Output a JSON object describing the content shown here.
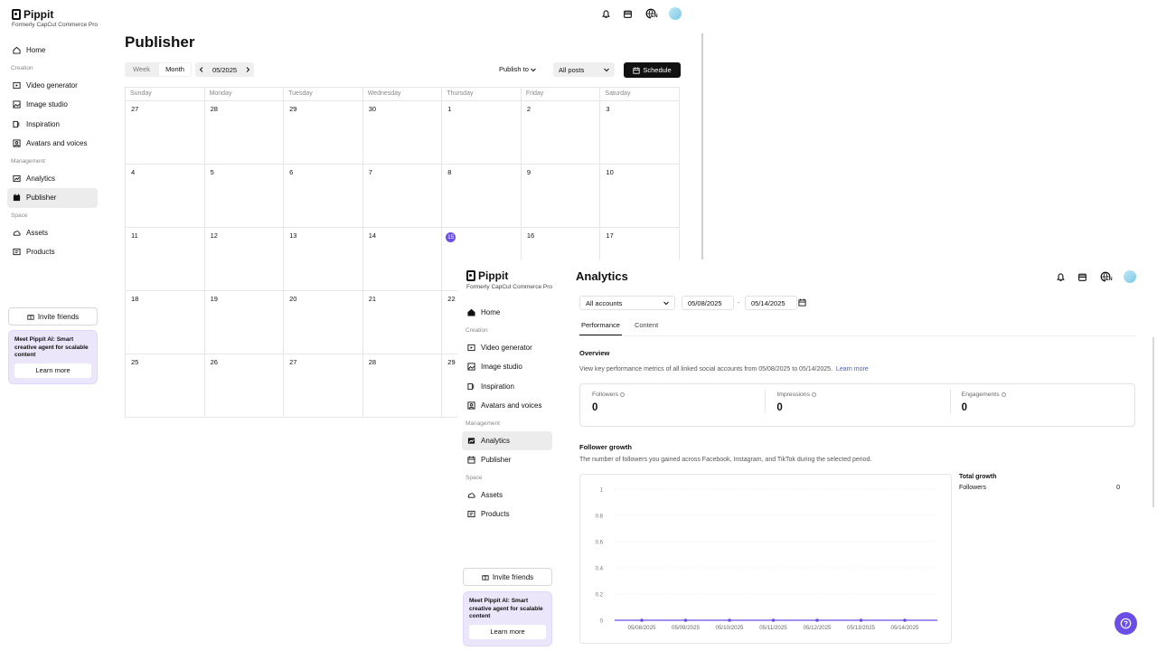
{
  "brand": {
    "name": "Pippit",
    "formerly": "Formerly CapCut Commerce Pro"
  },
  "nav": {
    "home": "Home",
    "sec_creation": "Creation",
    "video_generator": "Video generator",
    "image_studio": "Image studio",
    "inspiration": "Inspiration",
    "avatars": "Avatars and voices",
    "sec_management": "Management",
    "analytics": "Analytics",
    "publisher": "Publisher",
    "sec_space": "Space",
    "assets": "Assets",
    "products": "Products"
  },
  "invite": "Invite friends",
  "promo": {
    "text": "Meet Pippit AI: Smart creative agent for scalable content",
    "cta": "Learn more"
  },
  "topbar": {
    "lang": "EN"
  },
  "publisher": {
    "title": "Publisher",
    "view_week": "Week",
    "view_month": "Month",
    "current_month": "05/2025",
    "publish_to": "Publish to",
    "filter": "All posts",
    "schedule": "Schedule",
    "weekdays": [
      "Sunday",
      "Monday",
      "Tuesday",
      "Wednesday",
      "Thursday",
      "Friday",
      "Saturday"
    ],
    "weeks": [
      [
        "27",
        "28",
        "29",
        "30",
        "1",
        "2",
        "3"
      ],
      [
        "4",
        "5",
        "6",
        "7",
        "8",
        "9",
        "10"
      ],
      [
        "11",
        "12",
        "13",
        "14",
        "15",
        "16",
        "17"
      ],
      [
        "18",
        "19",
        "20",
        "21",
        "22",
        "",
        ""
      ],
      [
        "25",
        "26",
        "27",
        "28",
        "29",
        "",
        ""
      ]
    ],
    "today": "15"
  },
  "analytics": {
    "title": "Analytics",
    "accounts": "All accounts",
    "date_from": "05/08/2025",
    "date_sep": "-",
    "date_to": "05/14/2025",
    "tab_performance": "Performance",
    "tab_content": "Content",
    "overview_title": "Overview",
    "overview_desc": "View key performance metrics of all linked social accounts from 05/08/2025 to 05/14/2025.",
    "learn_more": "Learn more",
    "stats": [
      {
        "label": "Followers",
        "value": "0"
      },
      {
        "label": "Impressions",
        "value": "0"
      },
      {
        "label": "Engagements",
        "value": "0"
      }
    ],
    "growth_title": "Follower growth",
    "growth_desc": "The number of followers you gained across Facebook, Instagram, and TikTok during the selected period.",
    "total_growth": "Total growth",
    "total_label": "Followers",
    "total_value": "0"
  },
  "colors": {
    "accent": "#6b4ee6",
    "promo_bg": "#ece6fb",
    "primary_btn": "#111111"
  },
  "chart_data": {
    "type": "line",
    "x": [
      "05/08/2025",
      "05/09/2025",
      "05/10/2025",
      "05/11/2025",
      "05/12/2025",
      "05/13/2025",
      "05/14/2025"
    ],
    "series": [
      {
        "values": [
          0,
          0,
          0,
          0,
          0,
          0,
          0
        ]
      }
    ],
    "yticks": [
      "1",
      "0.8",
      "0.6",
      "0.4",
      "0.2",
      "0"
    ],
    "ylim": [
      0,
      1
    ],
    "grid": true,
    "color": "#6b4ee6"
  }
}
